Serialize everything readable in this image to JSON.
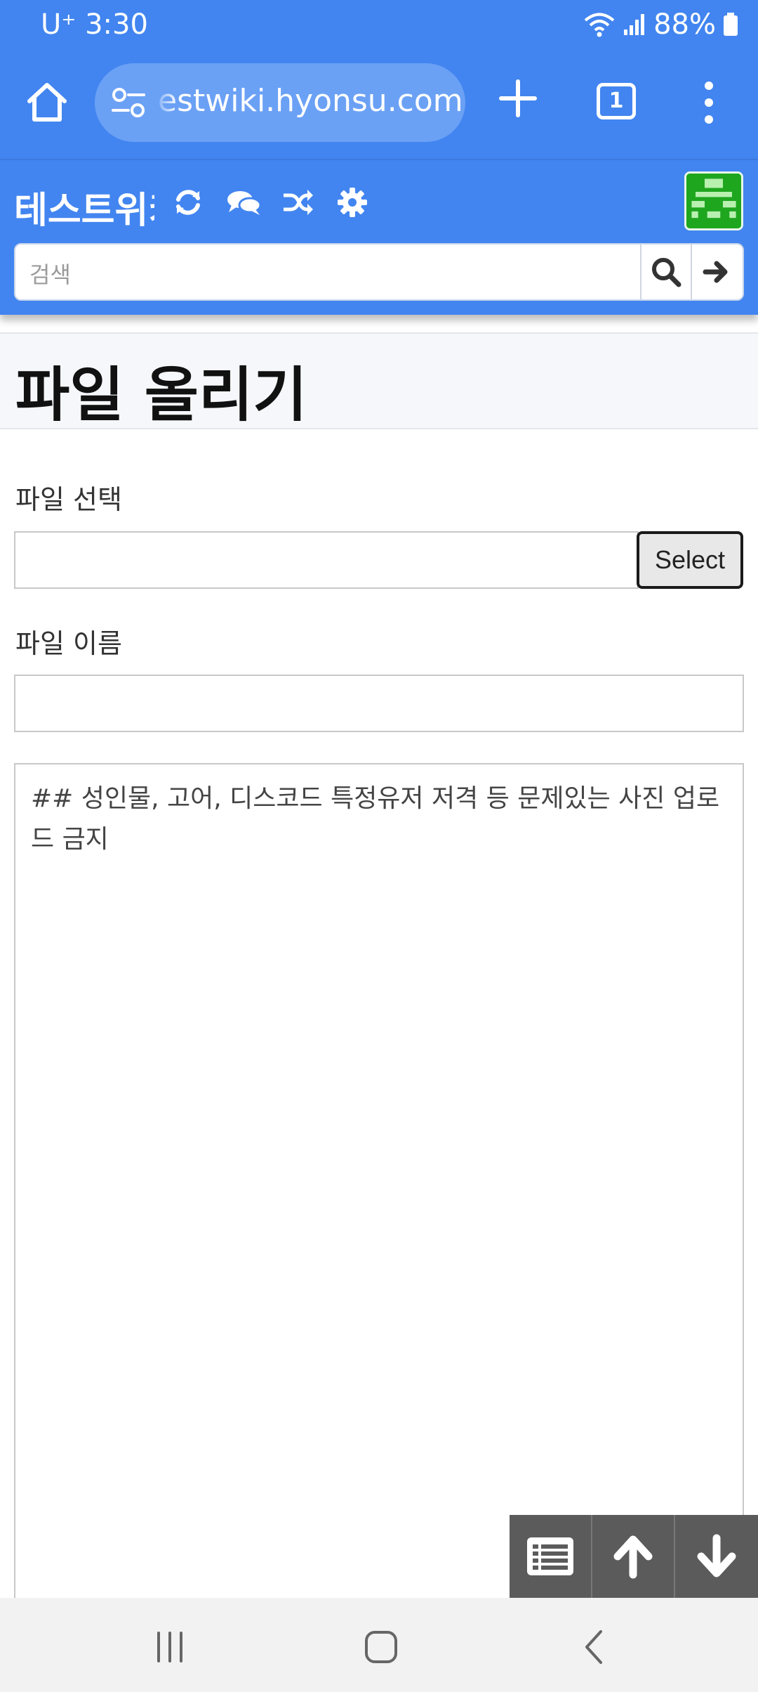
{
  "status_bar": {
    "carrier_time": "U⁺ 3:30",
    "battery": "88%"
  },
  "browser": {
    "url": "estwiki.hyonsu.com",
    "tab_count": "1"
  },
  "wiki": {
    "brand": "테스트위키",
    "search_placeholder": "검색",
    "avatar_color": "#1fa61f"
  },
  "page": {
    "title": "파일 올리기",
    "file_select_label": "파일 선택",
    "select_button": "Select",
    "file_name_label": "파일 이름",
    "description_text": "## 성인물, 고어, 디스코드 특정유저 저격 등 문제있는 사진 업로드 금지"
  },
  "colors": {
    "primary": "#4285f0",
    "title_bg": "#f5f7fa",
    "float_btn": "#5b5b5b"
  },
  "icons": {
    "header": [
      "refresh-icon",
      "discussion-icon",
      "random-icon",
      "settings-icon"
    ],
    "float": [
      "toc-icon",
      "arrow-up-icon",
      "arrow-down-icon"
    ],
    "nav": [
      "recent-apps-icon",
      "home-nav-icon",
      "back-icon"
    ]
  }
}
